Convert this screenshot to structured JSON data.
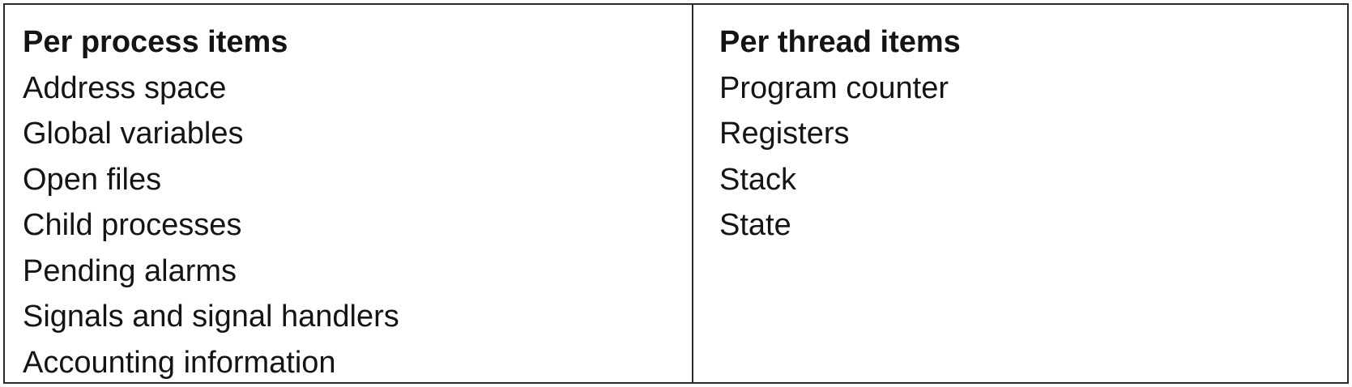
{
  "table": {
    "per_process": {
      "header": "Per process items",
      "items": [
        "Address space",
        "Global variables",
        "Open files",
        "Child processes",
        "Pending alarms",
        "Signals and signal handlers",
        "Accounting information"
      ]
    },
    "per_thread": {
      "header": "Per thread items",
      "items": [
        "Program counter",
        "Registers",
        "Stack",
        "State"
      ]
    }
  }
}
